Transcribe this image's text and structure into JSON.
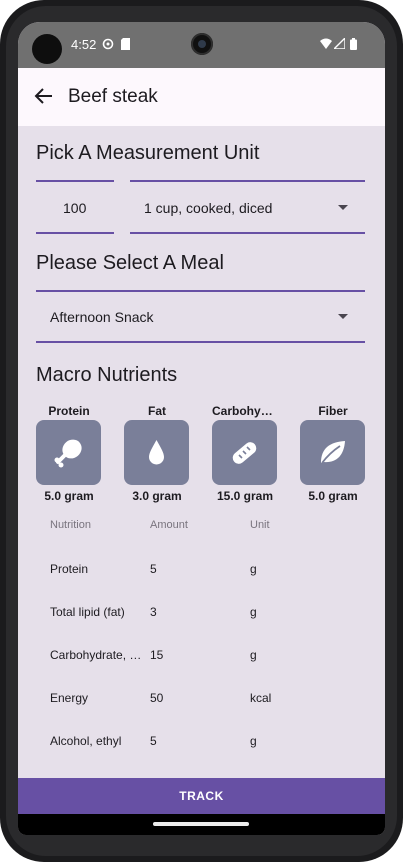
{
  "status_bar": {
    "time": "4:52",
    "left_icons": [
      "settings-gear-icon",
      "sd-card-icon"
    ],
    "right_icons": [
      "wifi-icon",
      "signal-icon",
      "battery-icon"
    ]
  },
  "app_bar": {
    "back_icon": "arrow-left-icon",
    "title": "Beef steak"
  },
  "measurement": {
    "heading": "Pick A Measurement Unit",
    "quantity": "100",
    "unit_selected": "1 cup, cooked, diced"
  },
  "meal": {
    "heading": "Please Select A Meal",
    "selected": "Afternoon Snack"
  },
  "macros": {
    "heading": "Macro Nutrients",
    "items": [
      {
        "label": "Protein",
        "value": "5.0 gram",
        "icon": "drumstick-icon"
      },
      {
        "label": "Fat",
        "value": "3.0 gram",
        "icon": "drop-icon"
      },
      {
        "label": "Carbohyde…",
        "value": "15.0 gram",
        "icon": "bread-icon"
      },
      {
        "label": "Fiber",
        "value": "5.0 gram",
        "icon": "leaf-icon"
      }
    ]
  },
  "table": {
    "headers": [
      "Nutrition",
      "Amount",
      "Unit"
    ],
    "rows": [
      {
        "name": "Protein",
        "amount": "5",
        "unit": "g"
      },
      {
        "name": "Total lipid (fat)",
        "amount": "3",
        "unit": "g"
      },
      {
        "name": "Carbohydrate, b…",
        "amount": "15",
        "unit": "g"
      },
      {
        "name": "Energy",
        "amount": "50",
        "unit": "kcal"
      },
      {
        "name": "Alcohol, ethyl",
        "amount": "5",
        "unit": "g"
      }
    ]
  },
  "track_label": "TRACK",
  "colors": {
    "accent": "#6750a4",
    "background": "#e6e0ea",
    "tile": "#7a7f99"
  }
}
